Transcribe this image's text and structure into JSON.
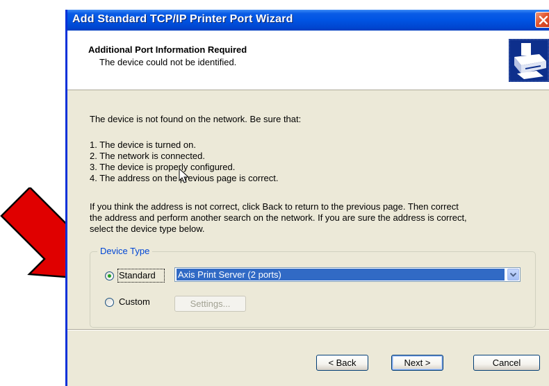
{
  "window": {
    "title": "Add Standard TCP/IP Printer Port Wizard"
  },
  "header": {
    "title": "Additional Port Information Required",
    "subtitle": "The device could not be identified."
  },
  "content": {
    "intro": "The device is not found on the network.  Be sure that:",
    "checklist": [
      "1.  The device is turned on.",
      "2.  The network is connected.",
      "3.  The device is properly configured.",
      "4.  The address on the previous page is correct."
    ],
    "instructions": [
      "If you think the address is not correct, click Back to return to the previous page.  Then correct",
      "the address and perform another search on the network.  If you are sure the address is correct,",
      "select the device type below."
    ]
  },
  "device_type": {
    "legend": "Device Type",
    "standard_label": "Standard",
    "standard_selected": true,
    "standard_value": "Axis Print Server (2 ports)",
    "custom_label": "Custom",
    "custom_selected": false,
    "settings_label": "Settings..."
  },
  "buttons": {
    "back": "< Back",
    "next": "Next >",
    "cancel": "Cancel"
  },
  "colors": {
    "title_bar": "#0054e3",
    "annotation_arrow": "#e00000",
    "selection": "#316ac5",
    "group_legend": "#0046d5"
  },
  "icons": {
    "wizard": "printer-icon",
    "close": "close-icon",
    "dropdown": "chevron-down-icon",
    "annotation": "red-arrow",
    "pointer": "mouse-cursor-icon"
  }
}
